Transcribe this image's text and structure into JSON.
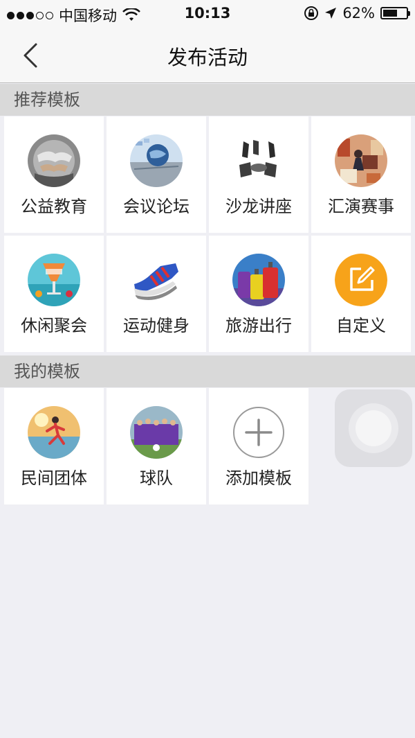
{
  "status_bar": {
    "carrier": "中国移动",
    "time": "10:13",
    "battery": "62%",
    "battery_level": 0.62
  },
  "nav": {
    "title": "发布活动",
    "back_icon": "chevron-left-icon"
  },
  "recommended": {
    "header": "推荐模板",
    "items": [
      {
        "label": "公益教育",
        "icon": "handshake-globe-icon"
      },
      {
        "label": "会议论坛",
        "icon": "globe-conference-icon"
      },
      {
        "label": "沙龙讲座",
        "icon": "chairs-icon"
      },
      {
        "label": "汇演赛事",
        "icon": "performance-icon"
      },
      {
        "label": "休闲聚会",
        "icon": "cocktail-icon"
      },
      {
        "label": "运动健身",
        "icon": "sneaker-icon"
      },
      {
        "label": "旅游出行",
        "icon": "luggage-icon"
      },
      {
        "label": "自定义",
        "icon": "edit-icon"
      }
    ]
  },
  "mine": {
    "header": "我的模板",
    "items": [
      {
        "label": "民间团体",
        "icon": "runner-icon"
      },
      {
        "label": "球队",
        "icon": "team-photo-icon"
      },
      {
        "label": "添加模板",
        "icon": "plus-icon"
      }
    ]
  },
  "colors": {
    "custom_accent": "#f7a31a",
    "background": "#efeff4",
    "section_header": "#d9d9d9"
  }
}
